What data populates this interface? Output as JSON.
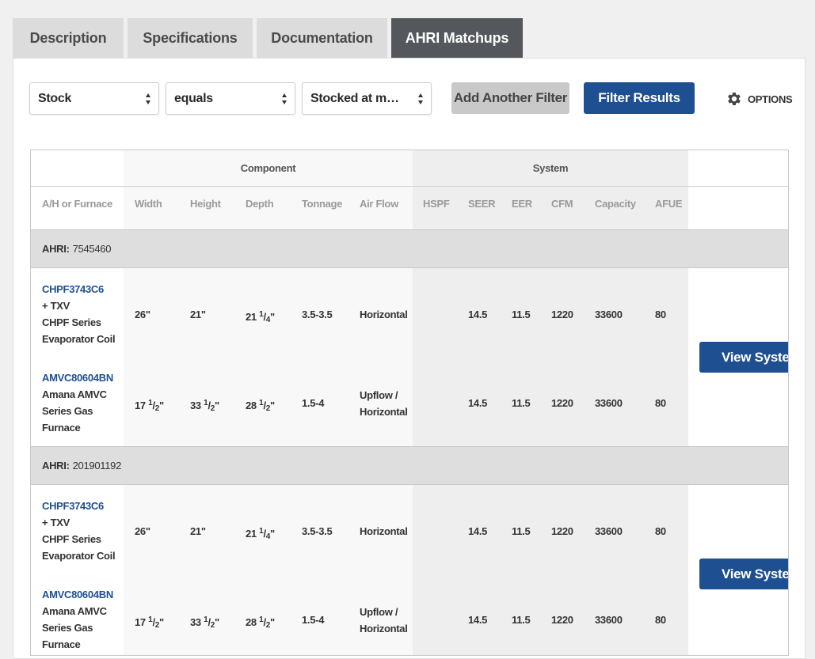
{
  "tabs": [
    {
      "label": "Description"
    },
    {
      "label": "Specifications"
    },
    {
      "label": "Documentation"
    },
    {
      "label": "AHRI Matchups",
      "active": true
    }
  ],
  "filters": {
    "field": "Stock",
    "operator": "equals",
    "value": "Stocked at my branc…",
    "add_label": "Add Another Filter",
    "apply_label": "Filter Results",
    "options_label": "OPTIONS"
  },
  "table": {
    "group_headers": {
      "component": "Component",
      "system": "System"
    },
    "columns": [
      "A/H or Furnace",
      "Width",
      "Height",
      "Depth",
      "Tonnage",
      "Air Flow",
      "HSPF",
      "SEER",
      "EER",
      "CFM",
      "Capacity",
      "AFUE"
    ],
    "ahri_label": "AHRI:",
    "view_label": "View System",
    "groups": [
      {
        "ahri": "7545460",
        "rows": [
          {
            "model": "CHPF3743C6",
            "desc": [
              "+ TXV",
              "CHPF Series",
              "Evaporator Coil"
            ],
            "width": "26\"",
            "height": "21\"",
            "depth": {
              "whole": "21",
              "num": "1",
              "den": "4"
            },
            "tonnage": "3.5-3.5",
            "airflow": [
              "Horizontal"
            ],
            "hspf": "",
            "seer": "14.5",
            "eer": "11.5",
            "cfm": "1220",
            "capacity": "33600",
            "afue": "80"
          },
          {
            "model": "AMVC80604BN",
            "desc": [
              "Amana AMVC",
              "Series Gas",
              "Furnace"
            ],
            "width": {
              "whole": "17",
              "num": "1",
              "den": "2"
            },
            "height": {
              "whole": "33",
              "num": "1",
              "den": "2"
            },
            "depth": {
              "whole": "28",
              "num": "1",
              "den": "2"
            },
            "tonnage": "1.5-4",
            "airflow": [
              "Upflow /",
              "Horizontal"
            ],
            "hspf": "",
            "seer": "14.5",
            "eer": "11.5",
            "cfm": "1220",
            "capacity": "33600",
            "afue": "80"
          }
        ]
      },
      {
        "ahri": "201901192",
        "rows": [
          {
            "model": "CHPF3743C6",
            "desc": [
              "+ TXV",
              "CHPF Series",
              "Evaporator Coil"
            ],
            "width": "26\"",
            "height": "21\"",
            "depth": {
              "whole": "21",
              "num": "1",
              "den": "4"
            },
            "tonnage": "3.5-3.5",
            "airflow": [
              "Horizontal"
            ],
            "hspf": "",
            "seer": "14.5",
            "eer": "11.5",
            "cfm": "1220",
            "capacity": "33600",
            "afue": "80"
          },
          {
            "model": "AMVC80604BN",
            "desc": [
              "Amana AMVC",
              "Series Gas",
              "Furnace"
            ],
            "width": {
              "whole": "17",
              "num": "1",
              "den": "2"
            },
            "height": {
              "whole": "33",
              "num": "1",
              "den": "2"
            },
            "depth": {
              "whole": "28",
              "num": "1",
              "den": "2"
            },
            "tonnage": "1.5-4",
            "airflow": [
              "Upflow /",
              "Horizontal"
            ],
            "hspf": "",
            "seer": "14.5",
            "eer": "11.5",
            "cfm": "1220",
            "capacity": "33600",
            "afue": "80"
          }
        ]
      }
    ]
  }
}
